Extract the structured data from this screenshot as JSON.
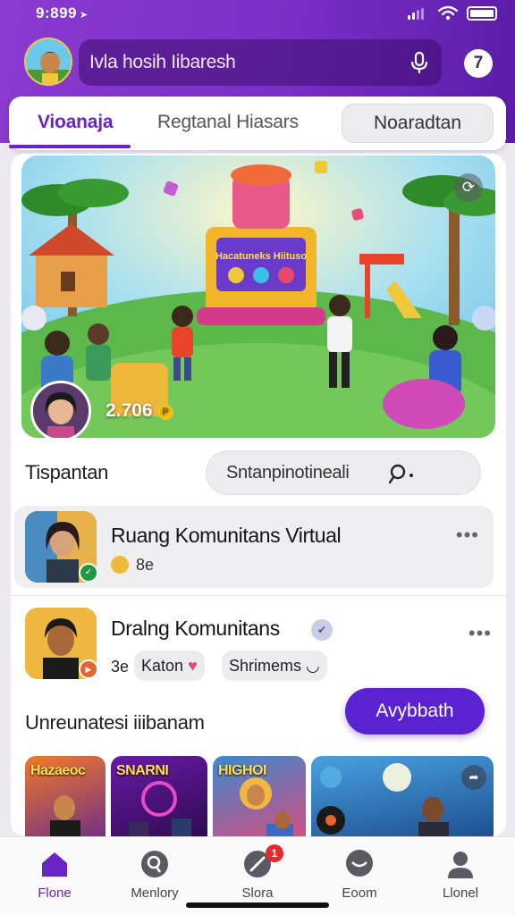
{
  "status_bar": {
    "time": "9:899"
  },
  "header": {
    "search_text": "Ivla hosih Iibaresh",
    "notification_count": "7"
  },
  "tabs": [
    {
      "label": "Vioanaja",
      "active": true
    },
    {
      "label": "Regtanal Hiasars",
      "active": false
    },
    {
      "label": "Noaradtan",
      "active": false
    }
  ],
  "hero": {
    "booth_text": "Hacatuneks Hiituso",
    "count": "2.706",
    "coin_symbol": "P"
  },
  "section_1": {
    "label": "Tispantan",
    "search_placeholder": "Sntanpinotineali"
  },
  "communities": [
    {
      "title": "Ruang Komunitans Virtual",
      "meta": "8e"
    },
    {
      "title": "Dralng Komunitans",
      "count": "3e",
      "chip_1": "Katon",
      "chip_2": "Shrimems"
    }
  ],
  "section_2": {
    "label": "Unreunatesi iiibanam",
    "cta_label": "Avybbath"
  },
  "thumbnails": [
    {
      "caption": "Hazaeoc"
    },
    {
      "caption": "SNARNI"
    },
    {
      "caption": "HIGHOI"
    },
    {
      "caption": ""
    }
  ],
  "bottom_nav": [
    {
      "label": "Flone",
      "icon": "home-icon",
      "active": true
    },
    {
      "label": "Menlory",
      "icon": "search-icon",
      "active": false
    },
    {
      "label": "Slora",
      "icon": "explore-icon",
      "active": false,
      "badge": "1"
    },
    {
      "label": "Eoom",
      "icon": "chat-icon",
      "active": false
    },
    {
      "label": "Llonel",
      "icon": "profile-icon",
      "active": false
    }
  ],
  "colors": {
    "brand_purple": "#7a2fc6",
    "accent_violet": "#5a22d0",
    "badge_red": "#e42a2a"
  }
}
